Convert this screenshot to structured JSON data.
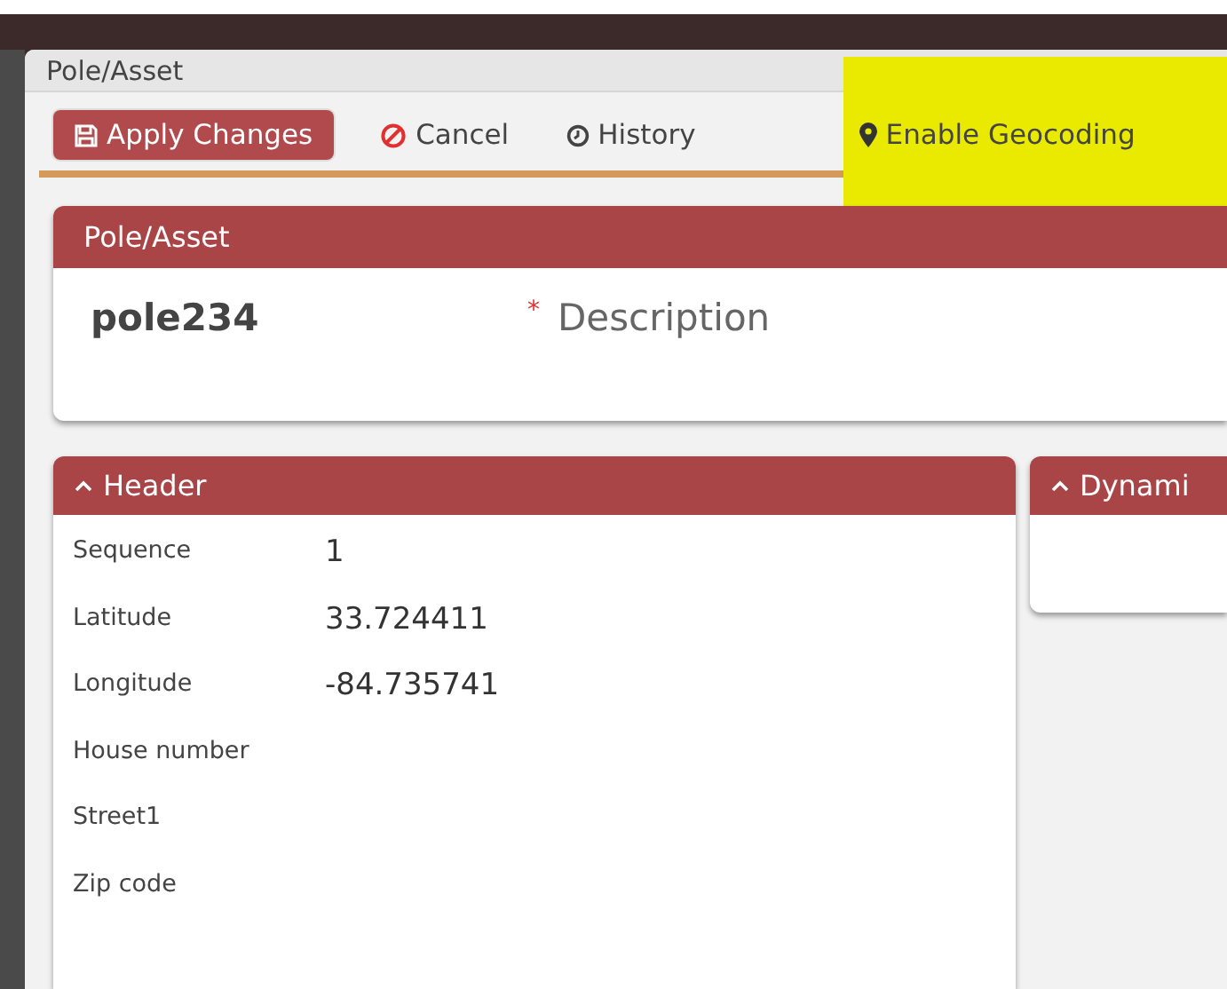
{
  "window": {
    "title": "Pole/Asset"
  },
  "toolbar": [
    {
      "kind": "primary",
      "label": "Apply Changes"
    },
    {
      "kind": "link",
      "label": "Cancel"
    },
    {
      "kind": "link",
      "label": "History"
    },
    {
      "kind": "link",
      "label": "Enable Geocoding",
      "highlighted": true
    }
  ],
  "asset_card": {
    "title": "Pole/Asset",
    "name": "pole234",
    "description": {
      "required_mark": "*",
      "placeholder": "Description"
    }
  },
  "sections": [
    {
      "title": "Header",
      "expanded": true,
      "fields": [
        {
          "label": "Sequence",
          "value": "1"
        },
        {
          "label": "Latitude",
          "value": "33.724411"
        },
        {
          "label": "Longitude",
          "value": "-84.735741"
        },
        {
          "label": "House number"
        },
        {
          "label": "Street1"
        },
        {
          "label": "Zip code"
        }
      ]
    },
    {
      "title": "Dynami",
      "expanded": true
    }
  ]
}
